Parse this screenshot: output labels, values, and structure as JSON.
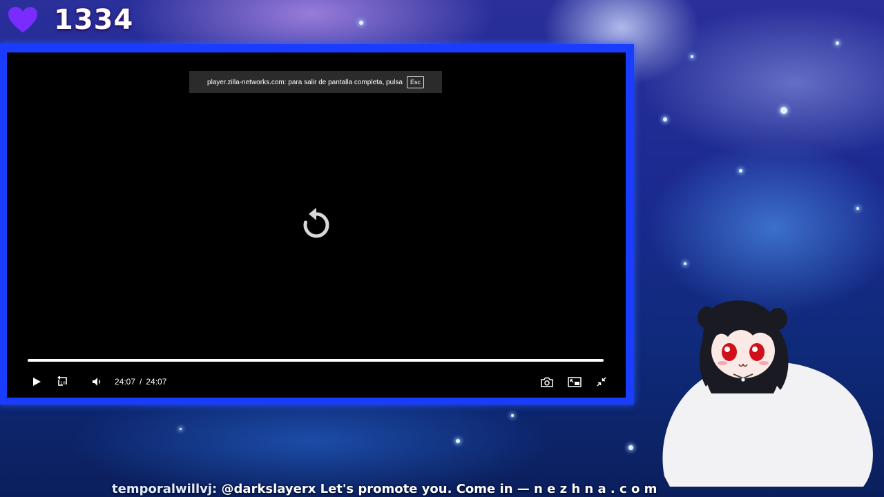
{
  "overlay": {
    "counter_value": "1334",
    "heart_icon": "heart-icon",
    "heart_color": "#7a2cff"
  },
  "player": {
    "fullscreen_notice": {
      "text": "player.zilla-networks.com: para salir de pantalla completa, pulsa",
      "key": "Esc"
    },
    "center_icon": "replay-icon",
    "progress": 1.0,
    "time": {
      "current": "24:07",
      "separator": "/",
      "duration": "24:07"
    },
    "controls": {
      "left": [
        "play-icon",
        "rewind-10-icon",
        "volume-icon"
      ],
      "right": [
        "screenshot-camera-icon",
        "picture-in-picture-icon",
        "exit-fullscreen-icon"
      ]
    },
    "frame_color": "#1a3cff"
  },
  "chat": {
    "username": "temporalwillvj:",
    "message": "@darkslayerx Let's promote you. Come in — n e z h n a . c o m"
  }
}
